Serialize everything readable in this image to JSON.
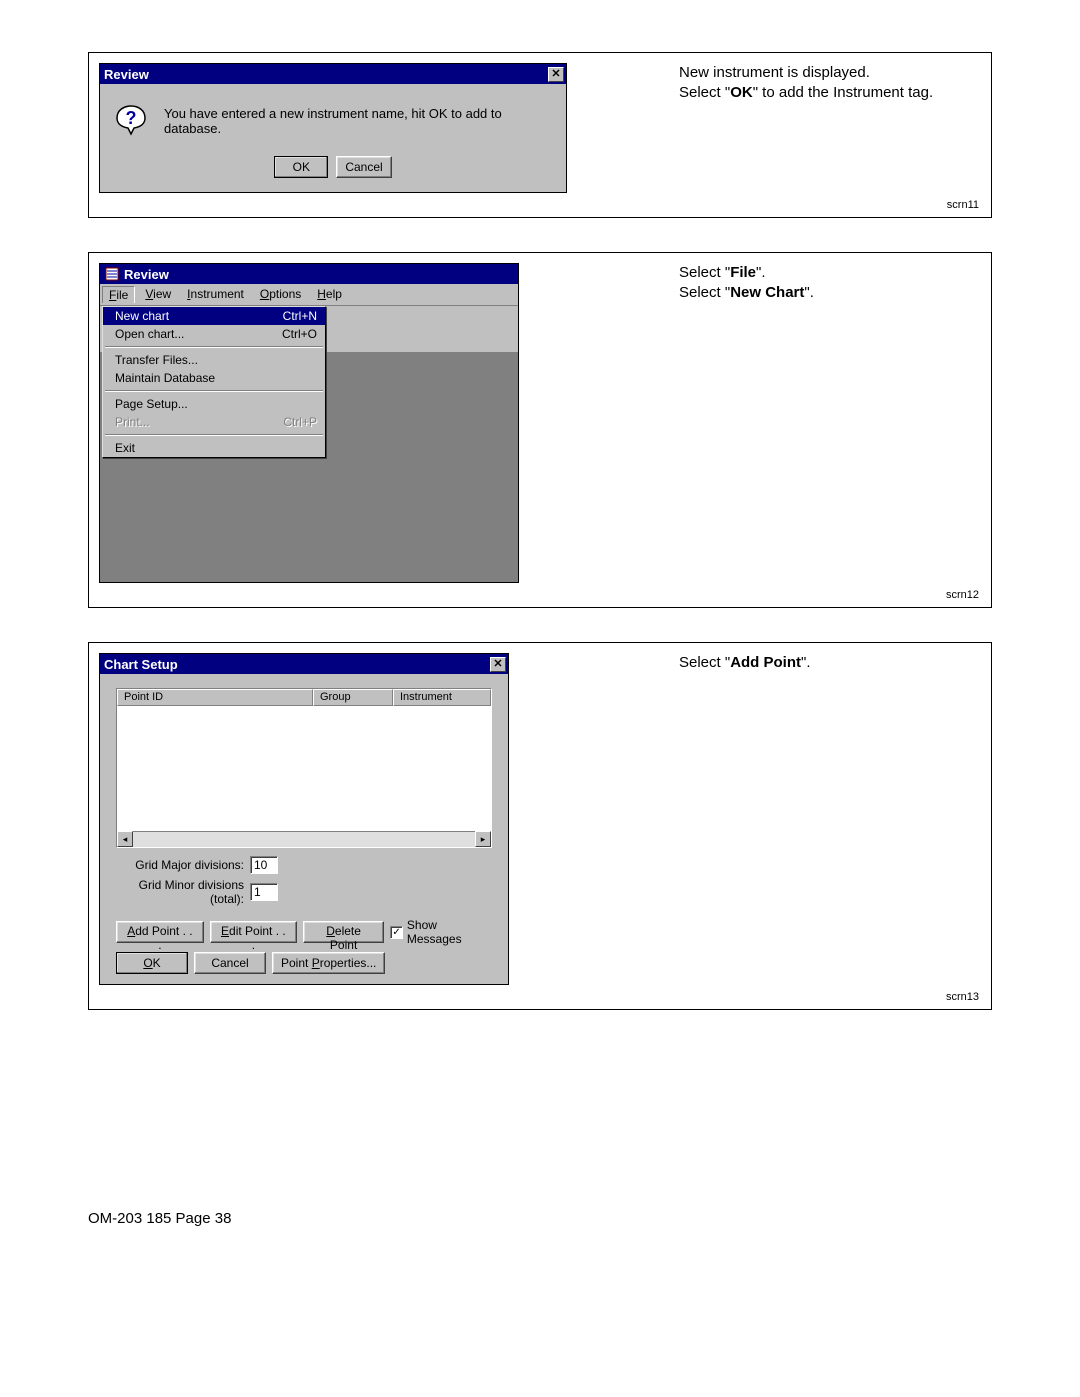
{
  "panel1": {
    "title": "Review",
    "message": "You have entered a new instrument name, hit OK to add to database.",
    "ok": "OK",
    "cancel": "Cancel",
    "side_line1": "New instrument is displayed.",
    "side_prefix": "Select \"",
    "side_bold": "OK",
    "side_suffix": "\" to add the Instrument tag.",
    "label": "scrn11"
  },
  "panel2": {
    "title": "Review",
    "menu": {
      "file": "File",
      "view": "View",
      "instrument": "Instrument",
      "options": "Options",
      "help": "Help"
    },
    "dropdown": {
      "new_chart": "New chart",
      "new_chart_sc": "Ctrl+N",
      "open_chart": "Open chart...",
      "open_chart_sc": "Ctrl+O",
      "transfer": "Transfer Files...",
      "maintain": "Maintain Database",
      "page_setup": "Page Setup...",
      "print": "Print...",
      "print_sc": "Ctrl+P",
      "exit": "Exit"
    },
    "side_a_pre": "Select \"",
    "side_a_bold": "File",
    "side_a_suf": "\".",
    "side_b_pre": "Select \"",
    "side_b_bold": "New Chart",
    "side_b_suf": "\".",
    "label": "scrn12"
  },
  "panel3": {
    "title": "Chart Setup",
    "cols": {
      "pointid": "Point ID",
      "group": "Group",
      "instrument": "Instrument"
    },
    "grid_major_label": "Grid Major divisions:",
    "grid_major_val": "10",
    "grid_minor_label": "Grid Minor divisions (total):",
    "grid_minor_val": "1",
    "btn_add": "Add Point . . .",
    "btn_edit": "Edit Point . . .",
    "btn_del": "Delete Point",
    "chk_show": "Show Messages",
    "btn_ok": "OK",
    "btn_cancel": "Cancel",
    "btn_props": "Point Properties...",
    "side_pre": "Select \"",
    "side_bold": "Add Point",
    "side_suf": "\".",
    "label": "scrn13"
  },
  "footer": "OM-203 185 Page 38"
}
